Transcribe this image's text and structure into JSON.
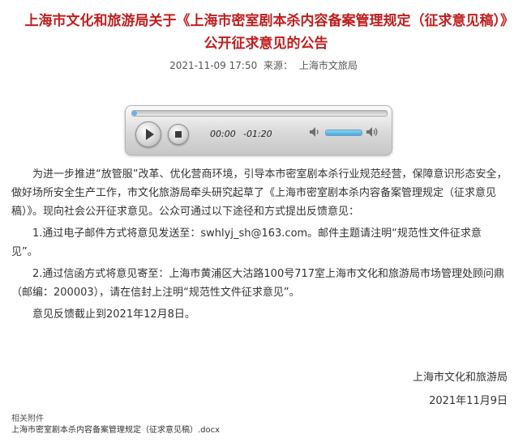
{
  "article": {
    "title": "上海市文化和旅游局关于《上海市密室剧本杀内容备案管理规定（征求意见稿）》公开征求意见的公告",
    "datetime": "2021-11-09 17:50",
    "source_label": "来源：",
    "source": "上海市文旅局"
  },
  "player": {
    "current_time": "00:00",
    "remaining_time": "-01:20",
    "progress": 0.02,
    "volume": 0.7,
    "icons": [
      "play-icon",
      "stop-icon",
      "volume-low-icon",
      "volume-high-icon"
    ]
  },
  "body": {
    "paragraphs": [
      "为进一步推进“放管服”改革、优化营商环境，引导本市密室剧本杀行业规范经营，保障意识形态安全，做好场所安全生产工作，市文化旅游局牵头研究起草了《上海市密室剧本杀内容备案管理规定（征求意见稿）》。现向社会公开征求意见。公众可通过以下途径和方式提出反馈意见：",
      "1.通过电子邮件方式将意见发送至：swhlyj_sh@163.com。邮件主题请注明“规范性文件征求意见”。",
      "2.通过信函方式将意见寄至：上海市黄浦区大沽路100号717室上海市文化和旅游局市场管理处顾问鼎（邮编：200003），请在信封上注明“规范性文件征求意见”。",
      "意见反馈截止到2021年12月8日。"
    ],
    "signature": "上海市文化和旅游局",
    "date": "2021年11月9日"
  },
  "attachments": {
    "label": "相关附件",
    "file": "上海市密室剧本杀内容备案管理规定（征求意见稿）.docx"
  },
  "colors": {
    "title": "#c01f1f",
    "text": "#333333",
    "progress": "#5ab8e8"
  }
}
